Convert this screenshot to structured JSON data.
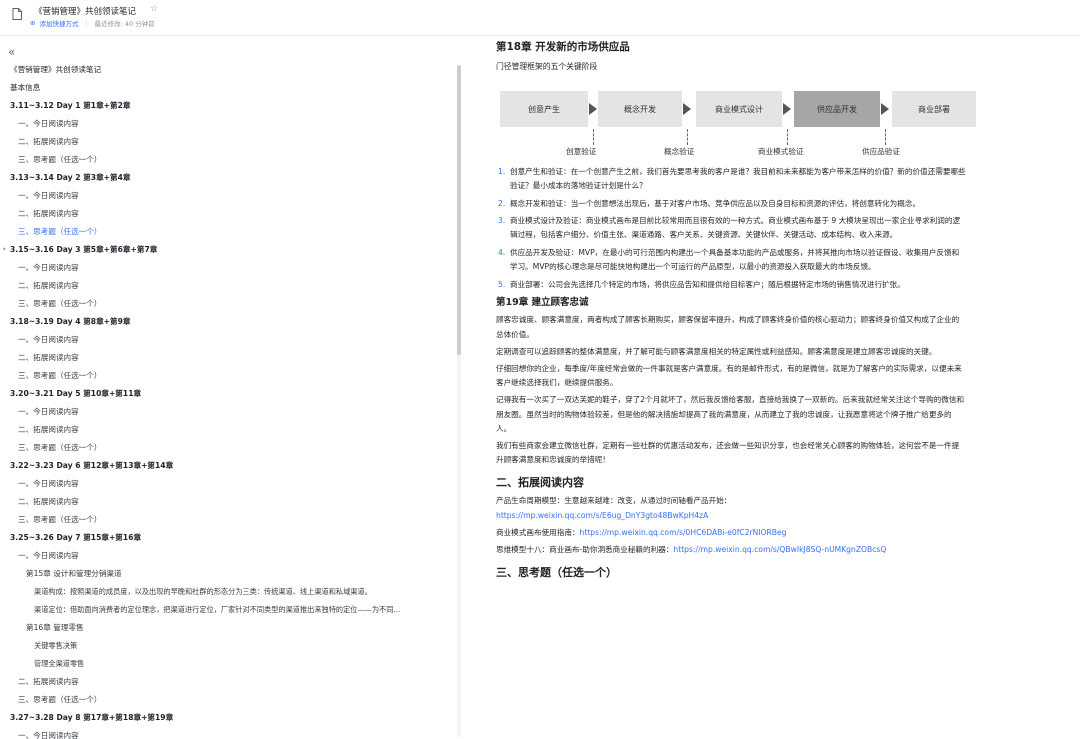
{
  "header": {
    "title": "《营销管理》共创领读笔记",
    "add_shortcut": "添加快捷方式",
    "last_modified": "最近修改: 40 分钟前"
  },
  "sidebar": {
    "collapse_glyph": "«",
    "items": [
      {
        "label": "《营销管理》共创领读笔记",
        "level": 0
      },
      {
        "label": "基本信息",
        "level": 0
      },
      {
        "label": "3.11~3.12 Day 1 第1章+第2章",
        "level": 1
      },
      {
        "label": "一、今日阅读内容",
        "level": 2
      },
      {
        "label": "二、拓展阅读内容",
        "level": 2
      },
      {
        "label": "三、思考题（任选一个）",
        "level": 2
      },
      {
        "label": "3.13~3.14 Day 2 第3章+第4章",
        "level": 1
      },
      {
        "label": "一、今日阅读内容",
        "level": 2
      },
      {
        "label": "二、拓展阅读内容",
        "level": 2
      },
      {
        "label": "三、思考题（任选一个）",
        "level": 2,
        "active": true
      },
      {
        "label": "3.15~3.16 Day 3 第5章+第6章+第7章",
        "level": 1,
        "marked": true
      },
      {
        "label": "一、今日阅读内容",
        "level": 2
      },
      {
        "label": "二、拓展阅读内容",
        "level": 2
      },
      {
        "label": "三、思考题（任选一个）",
        "level": 2
      },
      {
        "label": "3.18~3.19 Day 4 第8章+第9章",
        "level": 1
      },
      {
        "label": "一、今日阅读内容",
        "level": 2
      },
      {
        "label": "二、拓展阅读内容",
        "level": 2
      },
      {
        "label": "三、思考题（任选一个）",
        "level": 2
      },
      {
        "label": "3.20~3.21 Day 5 第10章+第11章",
        "level": 1
      },
      {
        "label": "一、今日阅读内容",
        "level": 2
      },
      {
        "label": "二、拓展阅读内容",
        "level": 2
      },
      {
        "label": "三、思考题（任选一个）",
        "level": 2
      },
      {
        "label": "3.22~3.23 Day 6 第12章+第13章+第14章",
        "level": 1
      },
      {
        "label": "一、今日阅读内容",
        "level": 2
      },
      {
        "label": "二、拓展阅读内容",
        "level": 2
      },
      {
        "label": "三、思考题（任选一个）",
        "level": 2
      },
      {
        "label": "3.25~3.26 Day 7 第15章+第16章",
        "level": 1
      },
      {
        "label": "一、今日阅读内容",
        "level": 2
      },
      {
        "label": "第15章 设计和管理分销渠道",
        "level": 3
      },
      {
        "label": "渠道构成：按照渠道的成员度，以及出现的早晚和社群的形态分为三类：传统渠道、线上渠道和私域渠道。",
        "level": 4
      },
      {
        "label": "渠道定位：借助面向消费者的定位理念，把渠道进行定位，厂家针对不同类型的渠道推出来独特的定位——为不同…",
        "level": 4
      },
      {
        "label": "第16章 管理零售",
        "level": 3
      },
      {
        "label": "关键零售决策",
        "level": 4
      },
      {
        "label": "管理全渠道零售",
        "level": 4
      },
      {
        "label": "二、拓展阅读内容",
        "level": 2
      },
      {
        "label": "三、思考题（任选一个）",
        "level": 2
      },
      {
        "label": "3.27~3.28 Day 8 第17章+第18章+第19章",
        "level": 1
      },
      {
        "label": "一、今日阅读内容",
        "level": 2
      }
    ]
  },
  "main": {
    "ch18_title": "第18章 开发新的市场供应品",
    "ch18_note": "门径管理框架的五个关键阶段",
    "flow": {
      "boxes": [
        "创意产生",
        "概念开发",
        "商业模式设计",
        "供应品开发",
        "商业部署"
      ],
      "highlight_index": 3,
      "labels": [
        "创意验证",
        "概念验证",
        "商业模式验证",
        "供应品验证"
      ]
    },
    "steps": [
      "创意产生和验证：在一个创意产生之前，我们首先要思考我的客户是谁？我目前和未来都能为客户带来怎样的价值？新的价值还需要哪些验证？最小成本的落地验证计划是什么？",
      "概念开发和验证：当一个创意想法出现后，基于对客户市场、竞争供应品以及自身目标和资源的评估，将创意转化为概念。",
      "商业模式设计及验证：商业模式画布是目前比较常用而且很有效的一种方式。商业模式画布基于 9 大模块呈现出一家企业寻求利润的逻辑过程，包括客户细分、价值主张、渠道通路、客户关系、关键资源、关键伙伴、关键活动、成本结构、收入来源。",
      "供应品开发及验证：MVP，在最小的可行范围内构建出一个具备基本功能的产品或服务，并将其推向市场以验证假设、收集用户反馈和学习。MVP的核心理念是尽可能快地构建出一个可运行的产品原型，以最小的资源投入获取最大的市场反馈。",
      "商业部署：公司会先选择几个特定的市场，将供应品告知和提供给目标客户；随后根据特定市场的销售情况进行扩张。"
    ],
    "ch19_title": "第19章 建立顾客忠诚",
    "ch19_paras": [
      "顾客忠诚度、顾客满意度，两者构成了顾客长期购买，顾客保留率提升，构成了顾客终身价值的核心驱动力；顾客终身价值又构成了企业的总体价值。",
      "定期调查可以追踪顾客的整体满意度，并了解可能与顾客满意度相关的特定属性或利益感知。顾客满意度是建立顾客忠诚度的关键。",
      "仔细回想你的企业，每季度/年度经常会做的一件事就是客户满意度。有的是邮件形式，有的是微信，就是为了解客户的实际需求，以便未来客户继续选择我们，继续提供服务。",
      "记得我有一次买了一双达芙妮的鞋子，穿了2个月就坏了，然后我反馈给客服，直接给我换了一双新的。后来我就经常关注这个导购的微信和朋友圈。虽然当时的购物体验较差，但是他的解决措施却提高了我的满意度，从而建立了我的忠诚度，让我愿意将这个牌子推广给更多的人。",
      "我们有些商家会建立微信社群，定期有一些社群的优惠活动发布，还会做一些知识分享，也会经常关心顾客的购物体验，这何尝不是一件提升顾客满意度和忠诚度的举措呢！"
    ],
    "ext_title": "二、拓展阅读内容",
    "ext_items": [
      {
        "label": "产品生命周期模型：生意越来越难：改变，从通过时间轴看产品开始：",
        "url": "https://mp.weixin.qq.com/s/E6ug_DnY3gto48BwKpH4zA",
        "newline": true
      },
      {
        "label": "商业模式画布使用指南：",
        "url": "https://mp.weixin.qq.com/s/0HC6DABi-e0fC2rNIORBeg",
        "newline": false
      },
      {
        "label": "思维模型十八：商业画布-助你洞悉商业秘籍的利器：",
        "url": "https://mp.weixin.qq.com/s/QBwIkJ8SQ-nUMKgnZOBcsQ",
        "newline": false
      }
    ],
    "think_title": "三、思考题（任选一个）"
  },
  "colors": {
    "accent": "#3370ff",
    "highlight_box": "#a6a6a6",
    "box": "#e4e4e4"
  }
}
